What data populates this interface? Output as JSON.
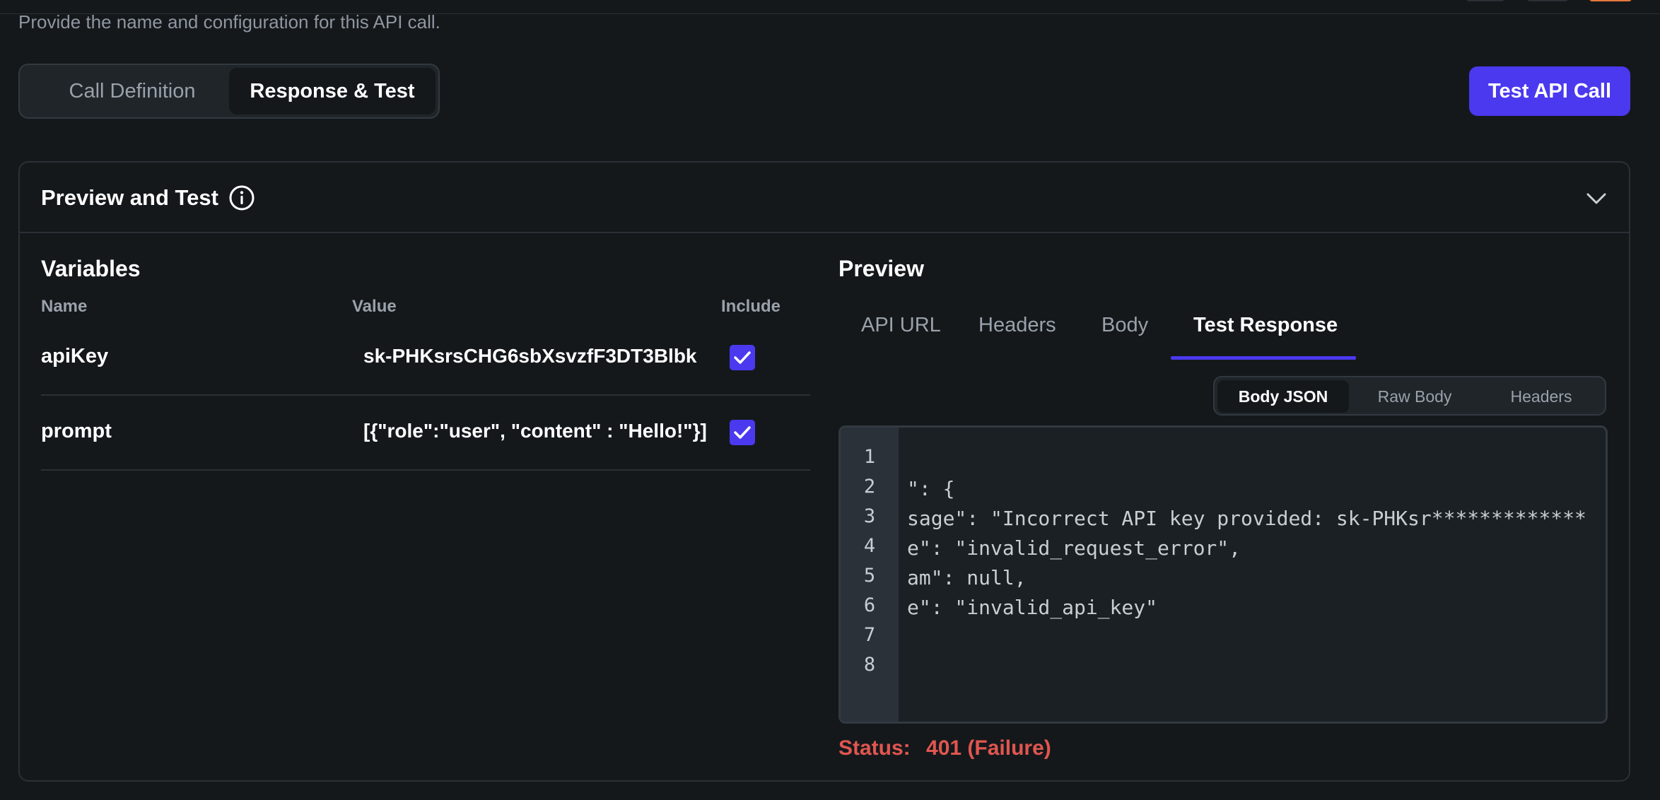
{
  "header": {
    "subtitle": "Provide the name and configuration for this API call."
  },
  "mode_tabs": {
    "call_definition": "Call Definition",
    "response_test": "Response & Test"
  },
  "test_button": "Test API Call",
  "card": {
    "title": "Preview and Test",
    "info_icon": "info-icon",
    "collapse_icon": "chevron-down-icon"
  },
  "variables": {
    "title": "Variables",
    "columns": {
      "name": "Name",
      "value": "Value",
      "include": "Include"
    },
    "rows": [
      {
        "name": "apiKey",
        "value": "sk-PHKsrsCHG6sbXsvzfF3DT3Blbk",
        "include": true
      },
      {
        "name": "prompt",
        "value": "[{\"role\":\"user\", \"content\" : \"Hello!\"}]",
        "include": true
      }
    ]
  },
  "preview": {
    "title": "Preview",
    "tabs": [
      "API URL",
      "Headers",
      "Body",
      "Test Response"
    ],
    "active_tab": "Test Response",
    "sub_tabs": [
      "Body JSON",
      "Raw Body",
      "Headers"
    ],
    "active_sub_tab": "Body JSON",
    "code_lines": [
      {
        "n": "1",
        "text": ""
      },
      {
        "n": "2",
        "text": "\": {"
      },
      {
        "n": "3",
        "text": "sage\": \"Incorrect API key provided: sk-PHKsr**************"
      },
      {
        "n": "4",
        "text": "e\": \"invalid_request_error\","
      },
      {
        "n": "5",
        "text": "am\": null,"
      },
      {
        "n": "6",
        "text": "e\": \"invalid_api_key\""
      },
      {
        "n": "7",
        "text": ""
      },
      {
        "n": "8",
        "text": ""
      }
    ],
    "status_label": "Status:",
    "status_value": "401 (Failure)"
  },
  "colors": {
    "background": "#14181b",
    "accent": "#4b39ef",
    "error": "#e0564f",
    "muted_text": "#9aa1aa"
  }
}
